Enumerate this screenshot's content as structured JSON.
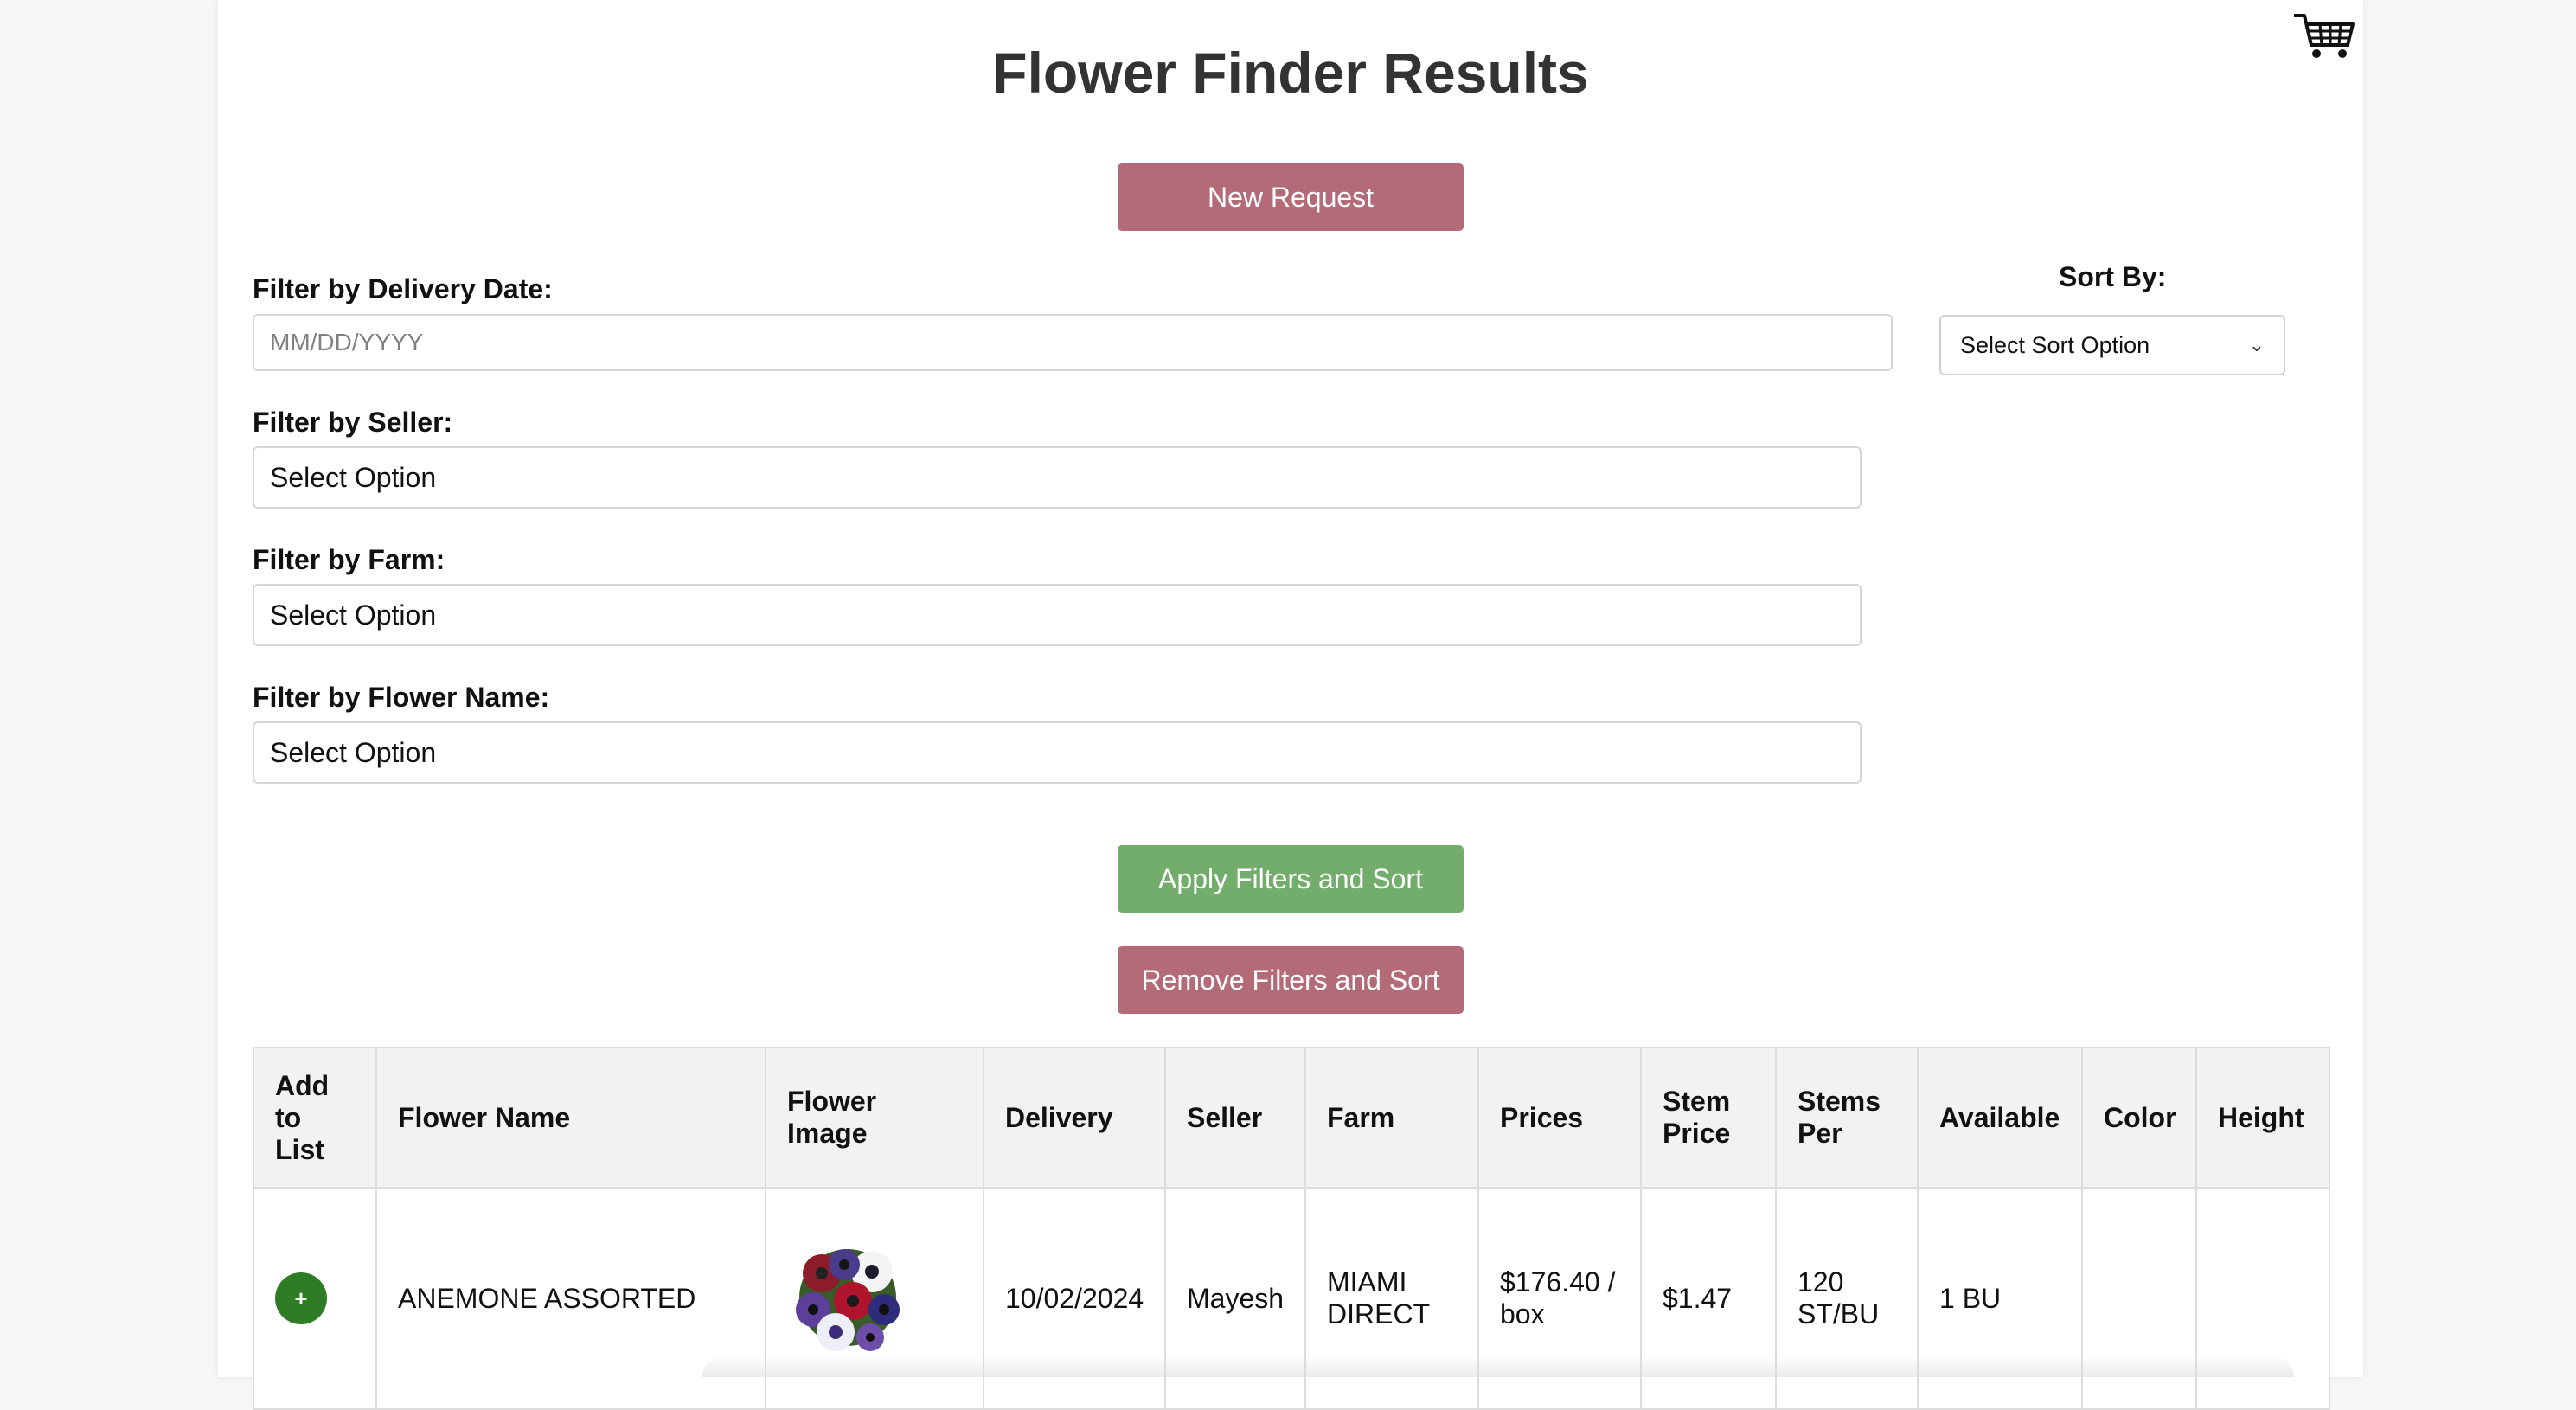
{
  "page": {
    "title": "Flower Finder Results"
  },
  "header": {
    "cart_icon": "shopping-cart-icon"
  },
  "buttons": {
    "new_request": "New Request",
    "apply": "Apply Filters and Sort",
    "remove": "Remove Filters and Sort"
  },
  "colors": {
    "rose": "#b36b78",
    "green": "#72ad6c",
    "add_green": "#2e7d25"
  },
  "filters": {
    "delivery_date": {
      "label": "Filter by Delivery Date:",
      "placeholder": "MM/DD/YYYY"
    },
    "seller": {
      "label": "Filter by Seller:",
      "value": "Select Option"
    },
    "farm": {
      "label": "Filter by Farm:",
      "value": "Select Option"
    },
    "flower_name": {
      "label": "Filter by Flower Name:",
      "value": "Select Option"
    }
  },
  "sort": {
    "label": "Sort By:",
    "value": "Select Sort Option"
  },
  "table": {
    "headers": [
      "Add to List",
      "Flower Name",
      "Flower Image",
      "Delivery",
      "Seller",
      "Farm",
      "Prices",
      "Stem Price",
      "Stems Per",
      "Available",
      "Color",
      "Height"
    ],
    "rows": [
      {
        "add": "+",
        "flower_name": "ANEMONE ASSORTED",
        "image": "anemone-bouquet-image",
        "delivery": "10/02/2024",
        "seller": "Mayesh",
        "farm": "MIAMI DIRECT",
        "prices": "$176.40 / box",
        "stem_price": "$1.47",
        "stems_per": "120 ST/BU",
        "available": "1 BU",
        "color": "",
        "height": ""
      }
    ]
  }
}
